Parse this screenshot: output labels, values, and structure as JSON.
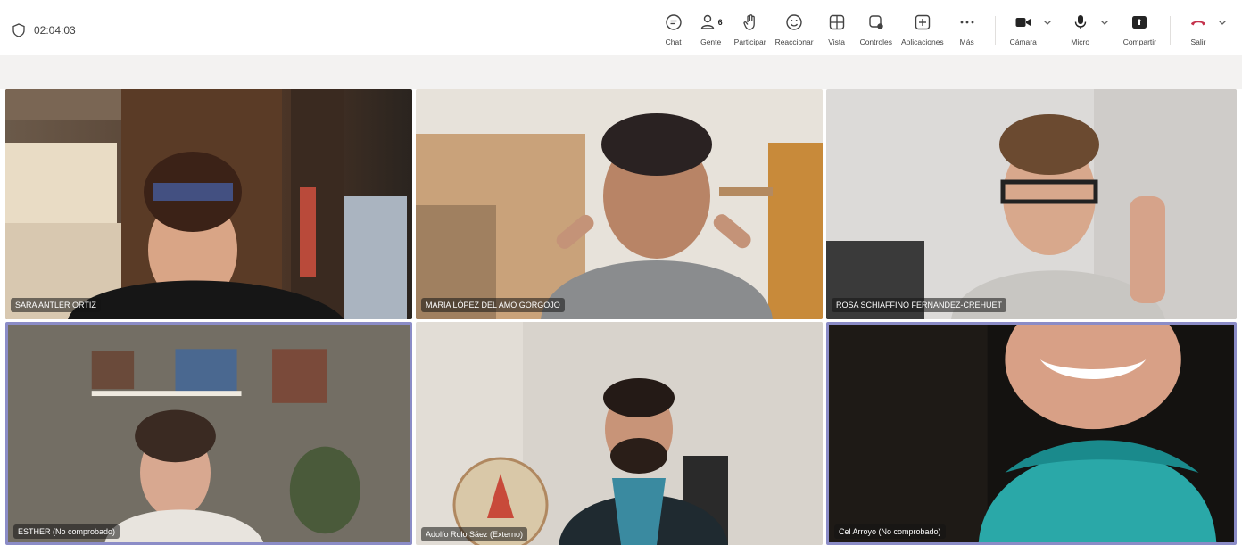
{
  "meeting": {
    "timer": "02:04:03"
  },
  "toolbar": {
    "chat": "Chat",
    "people": "Gente",
    "people_count": "6",
    "raise": "Participar",
    "react": "Reaccionar",
    "view": "Vista",
    "controls": "Controles",
    "apps": "Aplicaciones",
    "more": "Más",
    "camera": "Cámara",
    "mic": "Micro",
    "share": "Compartir",
    "leave": "Salir"
  },
  "participants": [
    {
      "name": "SARA ANTLER ORTIZ"
    },
    {
      "name": "MARÍA LÓPEZ DEL AMO GORGOJO"
    },
    {
      "name": "ROSA SCHIAFFINO FERNÁNDEZ-CREHUET"
    },
    {
      "name": "ESTHER (No comprobado)"
    },
    {
      "name": "Adolfo Rolo Sáez (Externo)"
    },
    {
      "name": "Cel Arroyo (No comprobado)"
    }
  ],
  "colors": {
    "active_border": "#8b8cc7",
    "leave_red": "#c4314b"
  }
}
